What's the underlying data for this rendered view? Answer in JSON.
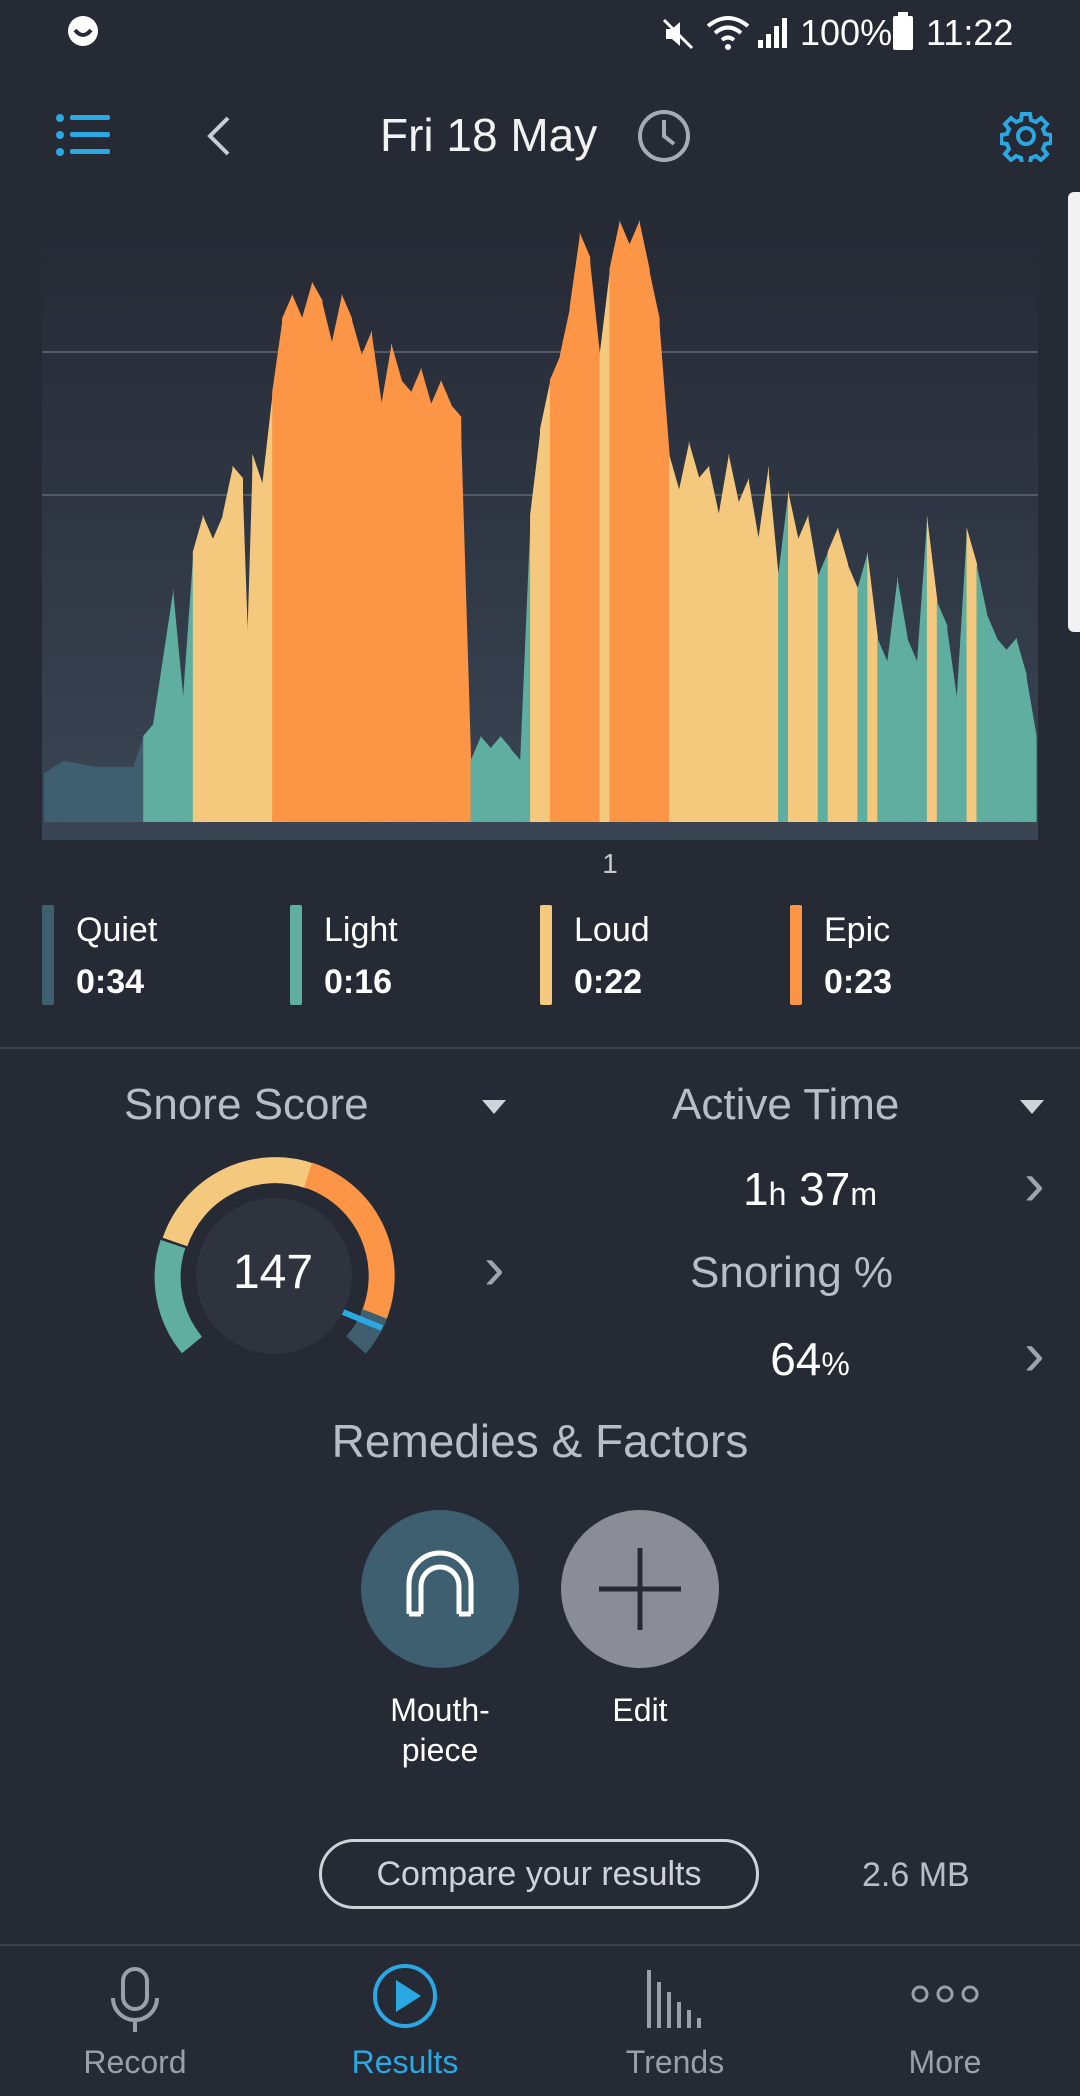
{
  "status_bar": {
    "battery": "100%",
    "time": "11:22"
  },
  "header": {
    "date": "Fri 18 May"
  },
  "chart_data": {
    "type": "area",
    "x_tick_labels": [
      "1"
    ],
    "series_levels": [
      "Quiet",
      "Light",
      "Loud",
      "Epic"
    ],
    "ylim": [
      0,
      100
    ],
    "grid": true,
    "profile": [
      [
        0,
        8,
        "Quiet"
      ],
      [
        2,
        10,
        "Quiet"
      ],
      [
        5,
        9,
        "Quiet"
      ],
      [
        9,
        9,
        "Quiet"
      ],
      [
        10,
        14,
        "Light"
      ],
      [
        11,
        16,
        "Light"
      ],
      [
        13,
        38,
        "Light"
      ],
      [
        14,
        20,
        "Light"
      ],
      [
        15,
        44,
        "Loud"
      ],
      [
        16,
        50,
        "Loud"
      ],
      [
        17,
        46,
        "Loud"
      ],
      [
        18,
        50,
        "Loud"
      ],
      [
        19,
        58,
        "Loud"
      ],
      [
        20,
        56,
        "Loud"
      ],
      [
        20.5,
        30,
        "Loud"
      ],
      [
        21,
        60,
        "Loud"
      ],
      [
        22,
        55,
        "Loud"
      ],
      [
        23,
        70,
        "Epic"
      ],
      [
        24,
        82,
        "Epic"
      ],
      [
        25,
        86,
        "Epic"
      ],
      [
        26,
        82,
        "Epic"
      ],
      [
        27,
        88,
        "Epic"
      ],
      [
        28,
        85,
        "Epic"
      ],
      [
        29,
        78,
        "Epic"
      ],
      [
        30,
        86,
        "Epic"
      ],
      [
        31,
        82,
        "Epic"
      ],
      [
        32,
        76,
        "Epic"
      ],
      [
        33,
        80,
        "Epic"
      ],
      [
        34,
        68,
        "Epic"
      ],
      [
        35,
        78,
        "Epic"
      ],
      [
        36,
        72,
        "Epic"
      ],
      [
        37,
        70,
        "Epic"
      ],
      [
        38,
        74,
        "Epic"
      ],
      [
        39,
        68,
        "Epic"
      ],
      [
        40,
        72,
        "Epic"
      ],
      [
        41,
        68,
        "Epic"
      ],
      [
        42,
        66,
        "Epic"
      ],
      [
        43,
        10,
        "Light"
      ],
      [
        44,
        14,
        "Light"
      ],
      [
        45,
        12,
        "Light"
      ],
      [
        46,
        14,
        "Light"
      ],
      [
        47,
        12,
        "Light"
      ],
      [
        48,
        10,
        "Light"
      ],
      [
        49,
        50,
        "Loud"
      ],
      [
        50,
        64,
        "Loud"
      ],
      [
        51,
        72,
        "Epic"
      ],
      [
        52,
        76,
        "Epic"
      ],
      [
        53,
        84,
        "Epic"
      ],
      [
        54,
        96,
        "Epic"
      ],
      [
        55,
        92,
        "Epic"
      ],
      [
        56,
        76,
        "Loud"
      ],
      [
        57,
        90,
        "Epic"
      ],
      [
        58,
        98,
        "Epic"
      ],
      [
        59,
        94,
        "Epic"
      ],
      [
        60,
        98,
        "Epic"
      ],
      [
        61,
        90,
        "Epic"
      ],
      [
        62,
        82,
        "Epic"
      ],
      [
        63,
        60,
        "Loud"
      ],
      [
        64,
        54,
        "Loud"
      ],
      [
        65,
        62,
        "Loud"
      ],
      [
        66,
        56,
        "Loud"
      ],
      [
        67,
        58,
        "Loud"
      ],
      [
        68,
        50,
        "Loud"
      ],
      [
        69,
        60,
        "Loud"
      ],
      [
        70,
        52,
        "Loud"
      ],
      [
        71,
        56,
        "Loud"
      ],
      [
        72,
        46,
        "Loud"
      ],
      [
        73,
        58,
        "Loud"
      ],
      [
        74,
        40,
        "Light"
      ],
      [
        75,
        54,
        "Loud"
      ],
      [
        76,
        46,
        "Loud"
      ],
      [
        77,
        50,
        "Loud"
      ],
      [
        78,
        40,
        "Light"
      ],
      [
        79,
        44,
        "Loud"
      ],
      [
        80,
        48,
        "Loud"
      ],
      [
        81,
        42,
        "Loud"
      ],
      [
        82,
        38,
        "Light"
      ],
      [
        83,
        44,
        "Loud"
      ],
      [
        84,
        30,
        "Light"
      ],
      [
        85,
        26,
        "Light"
      ],
      [
        86,
        40,
        "Light"
      ],
      [
        87,
        30,
        "Light"
      ],
      [
        88,
        26,
        "Light"
      ],
      [
        89,
        50,
        "Loud"
      ],
      [
        90,
        36,
        "Light"
      ],
      [
        91,
        32,
        "Light"
      ],
      [
        92,
        20,
        "Light"
      ],
      [
        93,
        48,
        "Loud"
      ],
      [
        94,
        42,
        "Light"
      ],
      [
        95,
        34,
        "Light"
      ],
      [
        96,
        30,
        "Light"
      ],
      [
        97,
        28,
        "Light"
      ],
      [
        98,
        30,
        "Light"
      ],
      [
        99,
        24,
        "Light"
      ],
      [
        100,
        14,
        "Light"
      ]
    ]
  },
  "legend": [
    {
      "name": "Quiet",
      "value": "0:34",
      "color": "#3f5f6f"
    },
    {
      "name": "Light",
      "value": "0:16",
      "color": "#5fae9f"
    },
    {
      "name": "Loud",
      "value": "0:22",
      "color": "#f4c97e"
    },
    {
      "name": "Epic",
      "value": "0:23",
      "color": "#fc9546"
    }
  ],
  "colors": {
    "accent": "#2aa8e4",
    "background": "#262a35"
  },
  "score_panel": {
    "title": "Snore Score",
    "score": "147",
    "active_time_title": "Active Time",
    "active_time_h": "1",
    "active_time_h_unit": "h",
    "active_time_m": "37",
    "active_time_m_unit": "m",
    "snoring_title": "Snoring %",
    "snoring_value": "64",
    "snoring_unit": "%"
  },
  "remedies": {
    "title": "Remedies & Factors",
    "items": [
      {
        "label_line1": "Mouth-",
        "label_line2": "piece",
        "icon": "mouthpiece-icon"
      },
      {
        "label_line1": "Edit",
        "icon": "plus-icon"
      }
    ]
  },
  "compare": {
    "label": "Compare your results",
    "file_size": "2.6 MB"
  },
  "nav": [
    {
      "label": "Record",
      "icon": "microphone-icon"
    },
    {
      "label": "Results",
      "icon": "play-icon",
      "active": true
    },
    {
      "label": "Trends",
      "icon": "bar-chart-icon"
    },
    {
      "label": "More",
      "icon": "more-dots-icon"
    }
  ]
}
